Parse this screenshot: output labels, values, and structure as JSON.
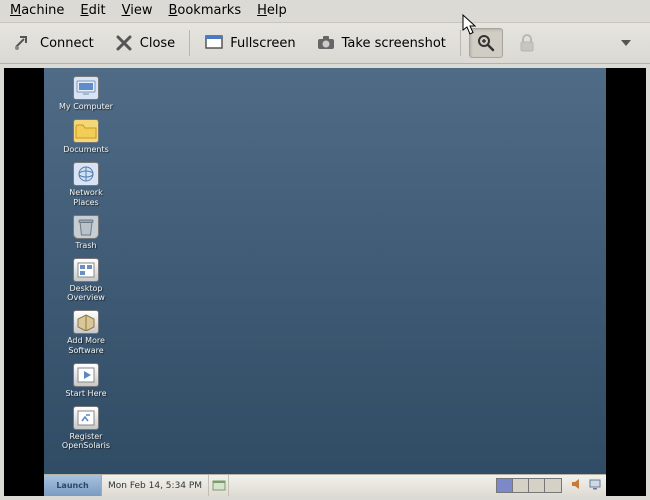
{
  "menubar": {
    "machine": "Machine",
    "edit": "Edit",
    "view": "View",
    "bookmarks": "Bookmarks",
    "help": "Help"
  },
  "toolbar": {
    "connect": "Connect",
    "close": "Close",
    "fullscreen": "Fullscreen",
    "screenshot": "Take screenshot"
  },
  "desktop_icons": [
    {
      "id": "my-computer",
      "label": "My Computer"
    },
    {
      "id": "documents",
      "label": "Documents"
    },
    {
      "id": "network-places",
      "label": "Network Places"
    },
    {
      "id": "trash",
      "label": "Trash"
    },
    {
      "id": "desktop-overview",
      "label": "Desktop Overview"
    },
    {
      "id": "add-more-software",
      "label": "Add More Software"
    },
    {
      "id": "start-here",
      "label": "Start Here"
    },
    {
      "id": "register-opensolaris",
      "label": "Register OpenSolaris"
    }
  ],
  "panel": {
    "launch_label": "Launch",
    "clock": "Mon Feb 14,  5:34 PM"
  }
}
